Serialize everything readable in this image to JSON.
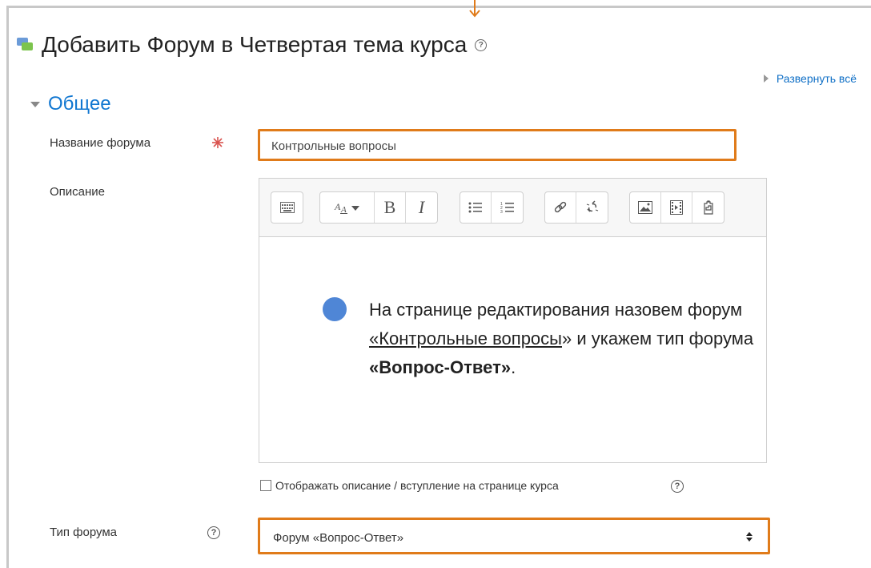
{
  "page": {
    "title": "Добавить Форум в Четвертая тема курса",
    "expand_all": "Развернуть всё"
  },
  "section": {
    "title": "Общее"
  },
  "form": {
    "forum_name_label": "Название форума",
    "forum_name_value": "Контрольные вопросы",
    "description_label": "Описание",
    "show_description_label": "Отображать описание / вступление на странице курса",
    "forum_type_label": "Тип форума",
    "forum_type_value": "Форум «Вопрос-Ответ»"
  },
  "editor": {
    "toolbar": [
      "toolbar-toggle-icon",
      "font-size-icon",
      "bold-icon",
      "italic-icon",
      "unordered-list-icon",
      "ordered-list-icon",
      "link-icon",
      "unlink-icon",
      "image-icon",
      "media-icon",
      "manage-files-icon"
    ],
    "bold_glyph": "B",
    "italic_glyph": "I"
  },
  "callout": {
    "part1": "На странице редактирования назовем форум ",
    "part2": "«Контрольные вопросы",
    "part3": "» и укажем тип форума ",
    "part4": "«Вопрос-Ответ»",
    "part5": "."
  },
  "colors": {
    "highlight": "#e07b1a",
    "link": "#1177d1",
    "bullet": "#4f86d6"
  }
}
